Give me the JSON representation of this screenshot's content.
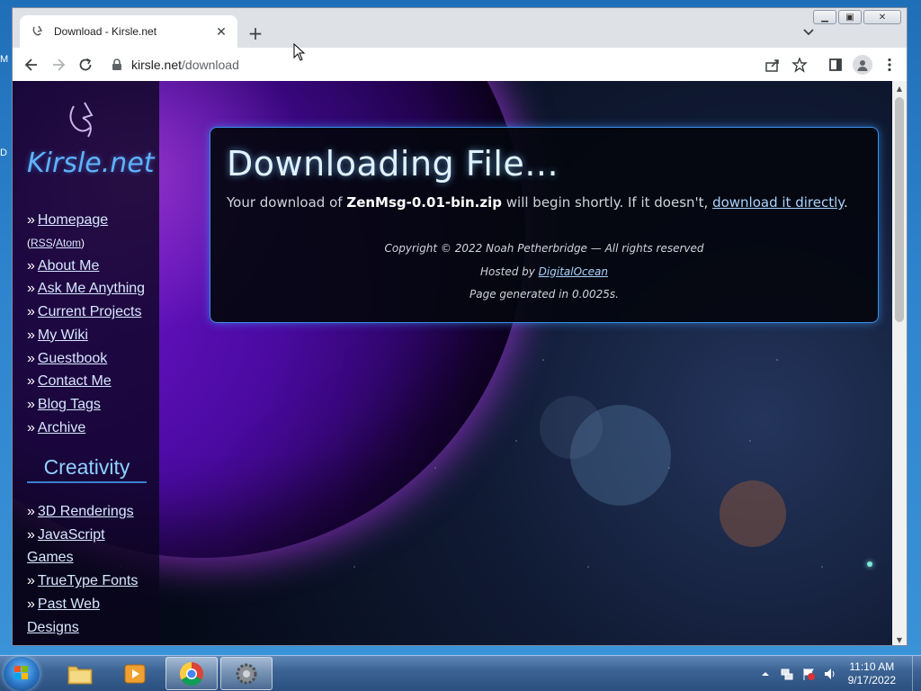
{
  "desktop": {
    "label_m": "M",
    "label_d": "D"
  },
  "browser": {
    "tab": {
      "title": "Download - Kirsle.net"
    },
    "address": {
      "host": "kirsle.net",
      "path": "/download"
    }
  },
  "sidebar": {
    "site_title": "Kirsle.net",
    "nav": [
      {
        "label": "Homepage"
      },
      {
        "label": "About Me"
      },
      {
        "label": "Ask Me Anything"
      },
      {
        "label": "Current Projects"
      },
      {
        "label": "My Wiki"
      },
      {
        "label": "Guestbook"
      },
      {
        "label": "Contact Me"
      },
      {
        "label": "Blog Tags"
      },
      {
        "label": "Archive"
      }
    ],
    "feeds": {
      "rss": "RSS",
      "sep": "/",
      "atom": "Atom",
      "open": "(",
      "close": ")"
    },
    "raquo": "»",
    "section_title": "Creativity",
    "creativity": [
      {
        "label": "3D Renderings"
      },
      {
        "label": "JavaScript",
        "cont": "Games"
      },
      {
        "label": "TrueType Fonts"
      },
      {
        "label": "Past Web",
        "cont": "Designs"
      }
    ]
  },
  "content": {
    "heading": "Downloading File...",
    "msg_prefix": "Your download of ",
    "filename": "ZenMsg-0.01-bin.zip",
    "msg_middle": " will begin shortly. If it doesn't, ",
    "direct_link": "download it directly",
    "msg_suffix": ".",
    "copyright": "Copyright © 2022 Noah Petherbridge — All rights reserved",
    "hosted_prefix": "Hosted by ",
    "host_link": "DigitalOcean",
    "generated": "Page generated in 0.0025s."
  },
  "taskbar": {
    "time": "11:10 AM",
    "date": "9/17/2022"
  },
  "colors": {
    "accent_blue": "#3b8fe8",
    "title_blue": "#5fb3ff",
    "planet_purple": "#6a14c8"
  }
}
